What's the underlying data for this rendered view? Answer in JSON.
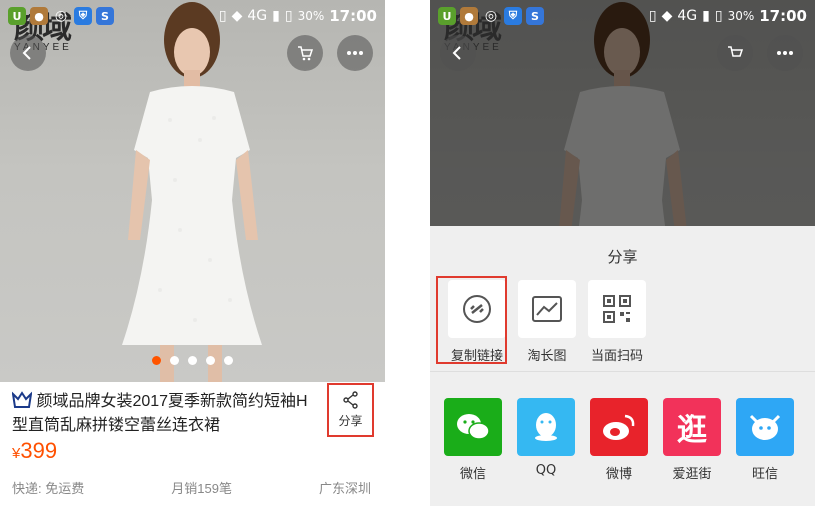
{
  "status_bar": {
    "network": "4G",
    "battery": "30%",
    "time": "17:00",
    "notification_icons": [
      "uc-icon",
      "monkey-icon",
      "weibo-icon",
      "shield-icon",
      "sogou-icon"
    ]
  },
  "brand": {
    "logo": "颜域",
    "sub": "YANYEE"
  },
  "product": {
    "title": "颜域品牌女装2017夏季新款简约短袖H型直筒乱麻拼镂空蕾丝连衣裙",
    "price_currency": "¥",
    "price": "399",
    "shipping": "快递: 免运费",
    "monthly_sales": "月销159笔",
    "location": "广东深圳",
    "share_label": "分享",
    "carousel_count": 5,
    "carousel_active_index": 0
  },
  "share_sheet": {
    "title": "分享",
    "tools": [
      {
        "label": "复制链接",
        "icon": "link-icon"
      },
      {
        "label": "淘长图",
        "icon": "image-chart-icon"
      },
      {
        "label": "当面扫码",
        "icon": "qr-code-icon"
      }
    ],
    "apps": [
      {
        "label": "微信",
        "icon": "wechat-icon",
        "color": "#1aad19"
      },
      {
        "label": "QQ",
        "icon": "qq-icon",
        "color": "#35b8f2"
      },
      {
        "label": "微博",
        "icon": "weibo-icon",
        "color": "#e8232b"
      },
      {
        "label": "爱逛街",
        "icon": "aiguangjie-icon",
        "color": "#f2325a"
      },
      {
        "label": "旺信",
        "icon": "wangxin-icon",
        "color": "#2ea7f5"
      }
    ]
  },
  "colors": {
    "accent": "#ff5000",
    "highlight": "#e03a2e"
  }
}
